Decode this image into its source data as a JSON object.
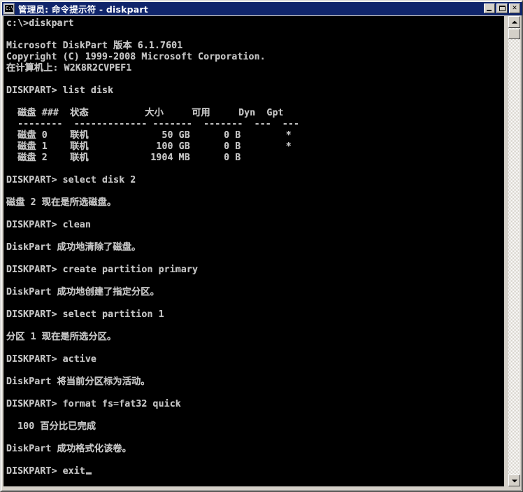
{
  "window": {
    "title": "管理员: 命令提示符 - diskpart",
    "system_icon": "console-icon",
    "icon_text": "C:\\",
    "title_bar_color": "#10256b",
    "frame_color": "#d4d0c8",
    "console_bg": "#000000",
    "console_fg": "#c0c0c0",
    "buttons": {
      "minimize_label": "_",
      "maximize_label": "□",
      "close_label": "✕"
    }
  },
  "scrollbar": {
    "up_arrow": "scroll-up-arrow",
    "down_arrow": "scroll-down-arrow",
    "thumb_position_percent": 0
  },
  "console": {
    "prompt_path": "c:\\>",
    "first_command": "diskpart",
    "program_name": "Microsoft DiskPart",
    "version_label": "版本",
    "version": "6.1.7601",
    "copyright": "Copyright (C) 1999-2008 Microsoft Corporation.",
    "computer_label": "在计算机上:",
    "computer_name": "W2K8R2CVPEF1",
    "prompt": "DISKPART>",
    "cursor": "block",
    "table": {
      "headers": [
        "磁盘 ###",
        "状态",
        "大小",
        "可用",
        "Dyn",
        "Gpt"
      ],
      "separators": [
        "--------",
        "-------------",
        "-------",
        "-------",
        "---",
        "---"
      ],
      "rows": [
        {
          "disk": "磁盘 0",
          "status": "联机",
          "size": "50 GB",
          "free": "0 B",
          "dyn": "",
          "gpt": "*"
        },
        {
          "disk": "磁盘 1",
          "status": "联机",
          "size": "100 GB",
          "free": "0 B",
          "dyn": "",
          "gpt": "*"
        },
        {
          "disk": "磁盘 2",
          "status": "联机",
          "size": "1904 MB",
          "free": "0 B",
          "dyn": "",
          "gpt": ""
        }
      ]
    },
    "commands": [
      {
        "cmd": "list disk",
        "output": ""
      },
      {
        "cmd": "select disk 2",
        "output": "磁盘 2 现在是所选磁盘。"
      },
      {
        "cmd": "clean",
        "output": "DiskPart 成功地清除了磁盘。"
      },
      {
        "cmd": "create partition primary",
        "output": "DiskPart 成功地创建了指定分区。"
      },
      {
        "cmd": "select partition 1",
        "output": "分区 1 现在是所选分区。"
      },
      {
        "cmd": "active",
        "output": "DiskPart 将当前分区标为活动。"
      },
      {
        "cmd": "format fs=fat32 quick",
        "output": "  100 百分比已完成\n\nDiskPart 成功格式化该卷。"
      },
      {
        "cmd": "exit",
        "output": ""
      }
    ],
    "full_text": "c:\\>diskpart\n\nMicrosoft DiskPart 版本 6.1.7601\nCopyright (C) 1999-2008 Microsoft Corporation.\n在计算机上: W2K8R2CVPEF1\n\nDISKPART> list disk\n\n  磁盘 ###  状态          大小     可用     Dyn  Gpt\n  --------  ------------- -------  -------  ---  ---\n  磁盘 0    联机             50 GB      0 B        *\n  磁盘 1    联机            100 GB      0 B        *\n  磁盘 2    联机           1904 MB      0 B\n\nDISKPART> select disk 2\n\n磁盘 2 现在是所选磁盘。\n\nDISKPART> clean\n\nDiskPart 成功地清除了磁盘。\n\nDISKPART> create partition primary\n\nDiskPart 成功地创建了指定分区。\n\nDISKPART> select partition 1\n\n分区 1 现在是所选分区。\n\nDISKPART> active\n\nDiskPart 将当前分区标为活动。\n\nDISKPART> format fs=fat32 quick\n\n  100 百分比已完成\n\nDiskPart 成功格式化该卷。\n\nDISKPART> exit"
  }
}
